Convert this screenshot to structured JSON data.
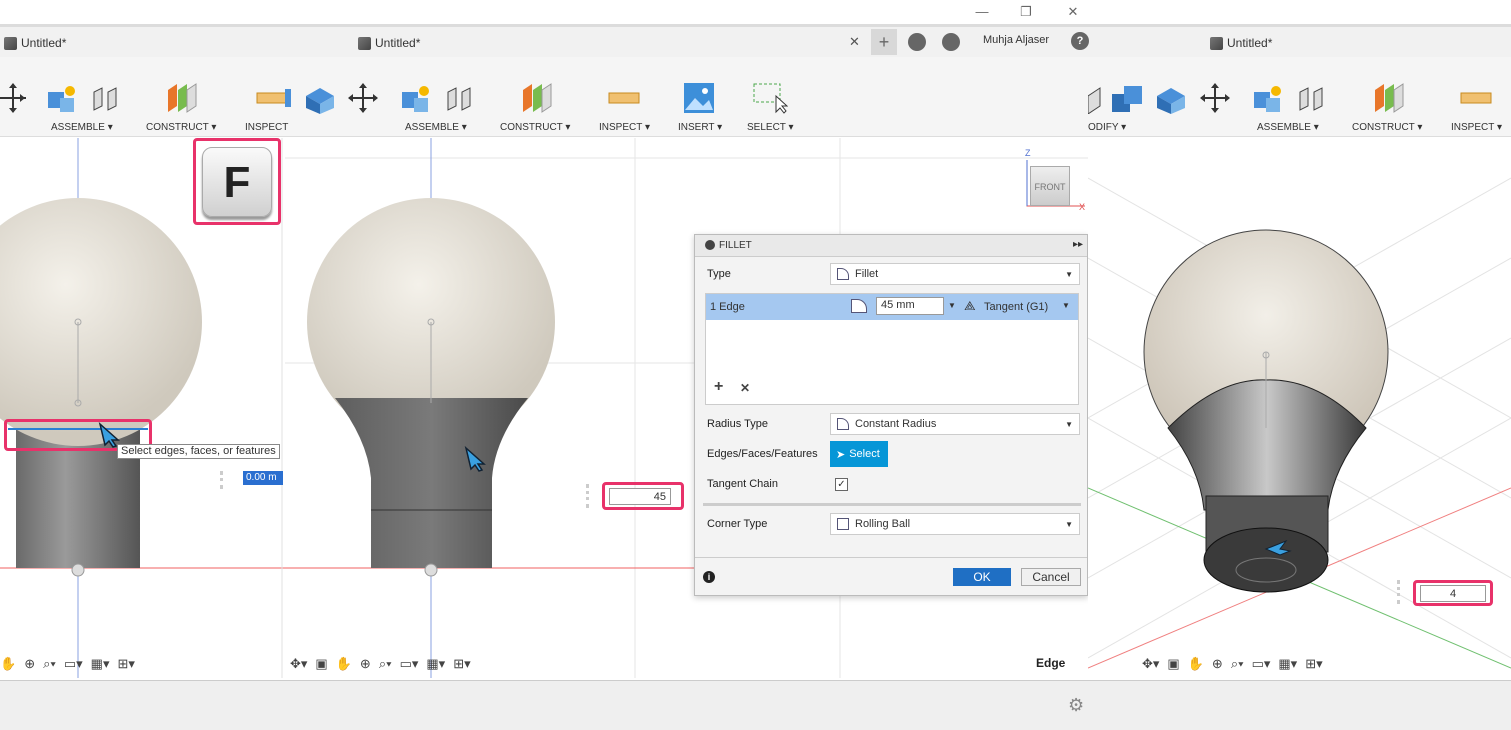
{
  "window": {
    "minimize": "—",
    "restore": "❐",
    "close": "✕"
  },
  "tabs": {
    "left": "Untitled*",
    "middle": "Untitled*",
    "right": "Untitled*",
    "close": "✕",
    "user": "Muhja Aljaser",
    "help": "?"
  },
  "toolbar": {
    "left": {
      "assemble": "ASSEMBLE ▾",
      "construct": "CONSTRUCT ▾",
      "inspect": "INSPECT"
    },
    "middle": {
      "assemble": "ASSEMBLE ▾",
      "construct": "CONSTRUCT ▾",
      "inspect": "INSPECT ▾",
      "insert": "INSERT ▾",
      "select": "SELECT ▾"
    },
    "right": {
      "modify": "ODIFY ▾",
      "assemble": "ASSEMBLE ▾",
      "construct": "CONSTRUCT ▾",
      "inspect": "INSPECT ▾"
    }
  },
  "shortcut_key": "F",
  "tooltip": "Select edges, faces, or features",
  "input_left": "0.00 m",
  "input_middle": "45",
  "input_right": "4",
  "viewcube": {
    "face": "FRONT",
    "z": "Z",
    "x": "X"
  },
  "status": {
    "edge": "Edge"
  },
  "fillet": {
    "title": "FILLET",
    "type_label": "Type",
    "type_value": "Fillet",
    "edge_label": "1 Edge",
    "radius": "45 mm",
    "tangent": "Tangent (G1)",
    "add": "+",
    "remove": "✕",
    "radius_type_label": "Radius Type",
    "radius_type_value": "Constant Radius",
    "efs_label": "Edges/Faces/Features",
    "select_btn": "Select",
    "tangent_chain_label": "Tangent Chain",
    "tangent_chain_checked": "✓",
    "corner_label": "Corner Type",
    "corner_value": "Rolling Ball",
    "ok": "OK",
    "cancel": "Cancel",
    "info": "i"
  },
  "colors": {
    "accent": "#e8326a",
    "blue_sel": "#0696d7",
    "row_sel": "#a5c8f0"
  }
}
